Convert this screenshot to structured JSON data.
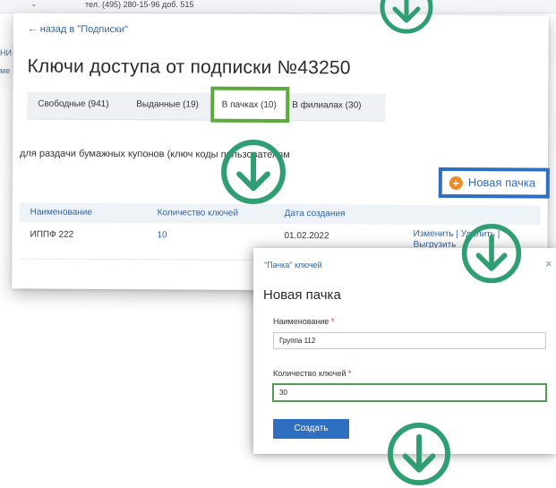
{
  "topbar": {
    "chevron": "⌄",
    "phone": "тел. (495) 280-15-96 доб. 515"
  },
  "left_fragment": {
    "line1": "НИ",
    "line2": "ме"
  },
  "page": {
    "back_link": "назад в \"Подписки\"",
    "title": "Ключи доступа от подписки №43250",
    "tabs": [
      {
        "label": "Свободные (941)"
      },
      {
        "label": "Выданные (19)"
      },
      {
        "label": "В пачках (10)",
        "active": true
      },
      {
        "label": "В филиалах (30)"
      }
    ],
    "description": "для раздачи бумажных купонов (ключ коды пользователям",
    "new_button": {
      "icon": "plus-icon",
      "icon_glyph": "+",
      "label": "Новая пачка"
    },
    "table": {
      "headers": [
        "Наименование",
        "Количество ключей",
        "Дата создания"
      ],
      "rows": [
        {
          "name": "ИППФ 222",
          "count": "10",
          "date": "01.02.2022",
          "actions": [
            "Изменить",
            "Удалить",
            "Выгрузить"
          ]
        }
      ]
    }
  },
  "modal": {
    "caption": "\"Пачка\" ключей",
    "close": "×",
    "title": "Новая пачка",
    "name_label": "Наименование",
    "name_value": "Группа 112",
    "count_label": "Количество ключей",
    "count_value": "30",
    "required_mark": "*",
    "submit": "Создать"
  },
  "colors": {
    "accent_blue": "#2f6fc2",
    "link_blue": "#2f64a8",
    "highlight_green": "#5cab3a",
    "annotation_teal": "#2f9e72",
    "orange": "#f08a24"
  },
  "annotations": {
    "icon": "arrow-down-circle-icon"
  }
}
